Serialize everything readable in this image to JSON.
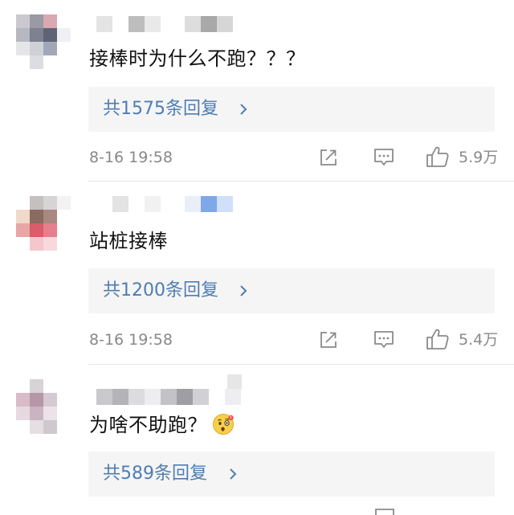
{
  "colors": {
    "link": "#4f7db3",
    "meta": "#888888",
    "reply_bg": "#f5f5f5"
  },
  "comments": [
    {
      "text": "接棒时为什么不跑？？？",
      "replies_label": "共1575条回复",
      "timestamp": "8-16 19:58",
      "likes": "5.9万"
    },
    {
      "text": "站桩接棒",
      "replies_label": "共1200条回复",
      "timestamp": "8-16 19:58",
      "likes": "5.4万"
    },
    {
      "text": "为啥不助跑？",
      "emoji": "thinking-face",
      "replies_label": "共589条回复"
    }
  ],
  "icons": {
    "share": "share-icon",
    "comment": "comment-icon",
    "like": "thumbs-up-icon",
    "chevron": "chevron-right-icon"
  }
}
